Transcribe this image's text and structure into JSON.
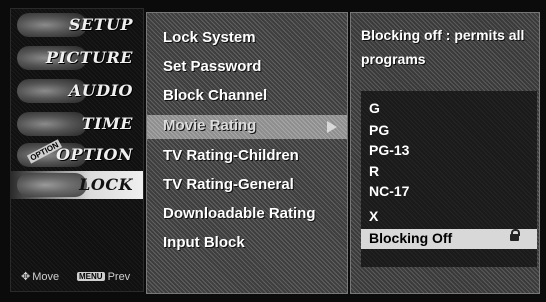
{
  "sidebar": {
    "items": [
      {
        "label": "SETUP"
      },
      {
        "label": "PICTURE"
      },
      {
        "label": "AUDIO"
      },
      {
        "label": "TIME"
      },
      {
        "label": "OPTION"
      },
      {
        "label": "LOCK"
      }
    ],
    "badge": "OPTION",
    "hint_move": "Move",
    "hint_menu_key": "MENU",
    "hint_prev": "Prev"
  },
  "menu": {
    "items": [
      {
        "label": "Lock System"
      },
      {
        "label": "Set Password"
      },
      {
        "label": "Block Channel"
      },
      {
        "label": "Movie Rating"
      },
      {
        "label": "TV Rating-Children"
      },
      {
        "label": "TV Rating-General"
      },
      {
        "label": "Downloadable Rating"
      },
      {
        "label": "Input Block"
      }
    ],
    "selected": "Movie Rating"
  },
  "detail": {
    "description": "Blocking off : permits all programs",
    "options": [
      {
        "label": "G"
      },
      {
        "label": "PG"
      },
      {
        "label": "PG-13"
      },
      {
        "label": "R"
      },
      {
        "label": "NC-17"
      },
      {
        "label": "X"
      },
      {
        "label": "Blocking Off"
      }
    ],
    "selected": "Blocking Off"
  }
}
